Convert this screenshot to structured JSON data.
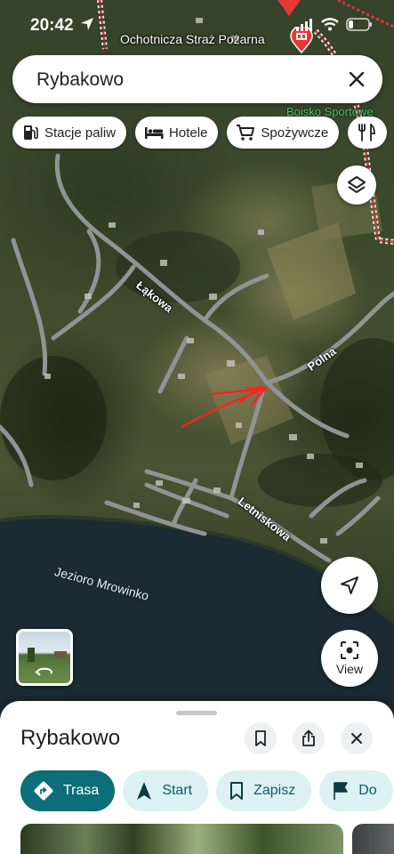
{
  "status_bar": {
    "time": "20:42"
  },
  "search": {
    "value": "Rybakowo"
  },
  "chips": [
    {
      "label": "Stacje paliw",
      "icon": "gas-station-icon"
    },
    {
      "label": "Hotele",
      "icon": "bed-icon"
    },
    {
      "label": "Spożywcze",
      "icon": "cart-icon"
    },
    {
      "label": "",
      "icon": "restaurant-icon"
    }
  ],
  "map": {
    "poi": "Ochotnicza Straż Pożarna",
    "green_label": "Boisko Sportowe",
    "streets": {
      "lakowa": "Łąkowa",
      "polna": "Polna",
      "letniskowa": "Letniskowa"
    },
    "lake": "Jezioro Mrowinko"
  },
  "view_button": {
    "label": "View"
  },
  "sheet": {
    "title": "Rybakowo",
    "actions": [
      {
        "label": "Trasa",
        "icon": "directions-icon"
      },
      {
        "label": "Start",
        "icon": "navigation-icon"
      },
      {
        "label": "Zapisz",
        "icon": "bookmark-icon"
      },
      {
        "label": "Do",
        "icon": "flag-icon"
      }
    ]
  },
  "colors": {
    "accent": "#0b6e78",
    "action_bg": "#dcf1f3",
    "marker": "#e53935",
    "drawn_arrow": "#ff2020"
  }
}
